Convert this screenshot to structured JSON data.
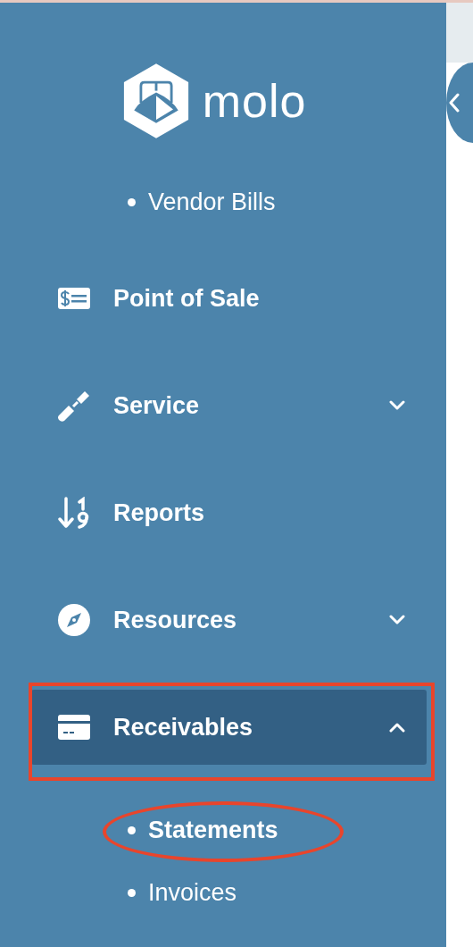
{
  "logo": {
    "text": "molo"
  },
  "partial_submenu": [
    {
      "label": "Vendor Bills",
      "selected": false
    }
  ],
  "nav": [
    {
      "label": "Point of Sale",
      "selected": false
    },
    {
      "label": "Service",
      "selected": false,
      "expanded": false
    },
    {
      "label": "Reports",
      "selected": false
    },
    {
      "label": "Resources",
      "selected": false,
      "expanded": false
    },
    {
      "label": "Receivables",
      "selected": true,
      "expanded": true,
      "highlighted": true,
      "children": [
        {
          "label": "Statements",
          "selected": true,
          "circled": true
        },
        {
          "label": "Invoices",
          "selected": false
        }
      ]
    }
  ]
}
